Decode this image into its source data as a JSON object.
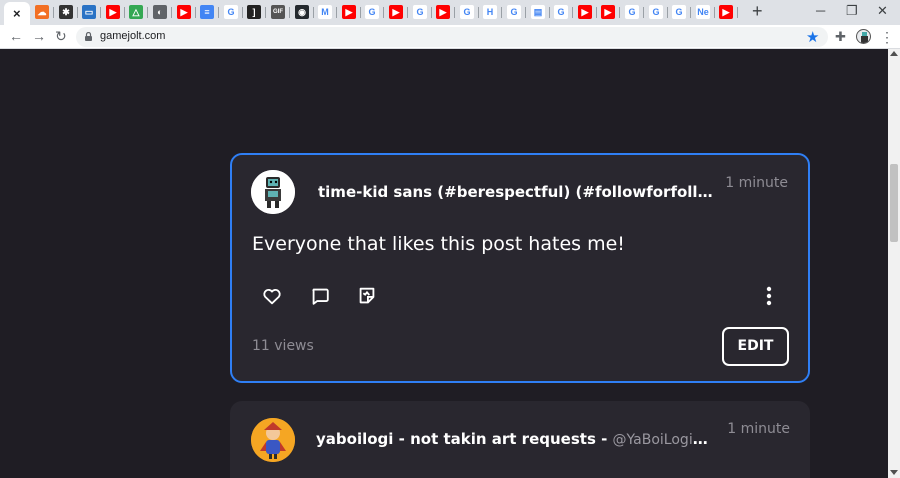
{
  "browser": {
    "tab_close_glyph": "×",
    "newtab_glyph": "+",
    "url": "gamejolt.com",
    "tabs": [
      {
        "icon": "soundcloud-icon",
        "color": "#f26f23",
        "glyph": "☁"
      },
      {
        "icon": "puzzle-dark-icon",
        "color": "#333333",
        "glyph": "✱"
      },
      {
        "icon": "blue-app-icon",
        "color": "#2a73c5",
        "glyph": "▭"
      },
      {
        "icon": "youtube-icon",
        "color": "#ff0000",
        "glyph": "▶"
      },
      {
        "icon": "google-drive-icon",
        "color": "#34a853",
        "glyph": "△"
      },
      {
        "icon": "globe-icon",
        "color": "#5f6368",
        "glyph": "◐"
      },
      {
        "icon": "youtube-icon",
        "color": "#ff0000",
        "glyph": "▶"
      },
      {
        "icon": "google-docs-icon",
        "color": "#4285f4",
        "glyph": "≡"
      },
      {
        "icon": "google-icon",
        "color": "#ffffff",
        "glyph": "G"
      },
      {
        "icon": "dark-tab-icon",
        "color": "#222222",
        "glyph": "]"
      },
      {
        "icon": "gif-icon",
        "color": "#555555",
        "glyph": "GIF"
      },
      {
        "icon": "github-icon",
        "color": "#24292e",
        "glyph": "◉"
      },
      {
        "icon": "gmail-icon",
        "color": "#ffffff",
        "glyph": "M"
      },
      {
        "icon": "youtube-icon",
        "color": "#ff0000",
        "glyph": "▶"
      },
      {
        "icon": "google-icon",
        "color": "#ffffff",
        "glyph": "G"
      },
      {
        "icon": "youtube-icon",
        "color": "#ff0000",
        "glyph": "▶"
      },
      {
        "icon": "google-icon",
        "color": "#ffffff",
        "glyph": "G"
      },
      {
        "icon": "youtube-icon",
        "color": "#ff0000",
        "glyph": "▶"
      },
      {
        "icon": "google-icon",
        "color": "#ffffff",
        "glyph": "G"
      },
      {
        "icon": "h-green-icon",
        "color": "#ffffff",
        "glyph": "H"
      },
      {
        "icon": "google-icon",
        "color": "#ffffff",
        "glyph": "G"
      },
      {
        "icon": "doc-red-icon",
        "color": "#ffffff",
        "glyph": "▤"
      },
      {
        "icon": "google-icon",
        "color": "#ffffff",
        "glyph": "G"
      },
      {
        "icon": "youtube-icon",
        "color": "#ff0000",
        "glyph": "▶"
      },
      {
        "icon": "youtube-icon",
        "color": "#ff0000",
        "glyph": "▶"
      },
      {
        "icon": "google-icon",
        "color": "#ffffff",
        "glyph": "G"
      },
      {
        "icon": "google-icon",
        "color": "#ffffff",
        "glyph": "G"
      },
      {
        "icon": "google-icon",
        "color": "#ffffff",
        "glyph": "G"
      },
      {
        "icon": "new-tab-label",
        "color": "#ffffff",
        "glyph": "Ne"
      },
      {
        "icon": "youtube-icon",
        "color": "#ff0000",
        "glyph": "▶"
      }
    ]
  },
  "feed": {
    "posts": [
      {
        "author": "time-kid sans (#berespectful) (#followforfollow) (...",
        "time": "1 minute",
        "text": "Everyone that likes this post hates me!",
        "views": "11 views",
        "edit_label": "EDIT"
      },
      {
        "author": "yaboilogi - not takin art requests - ",
        "handle": "@YaBoiLogi_Tha_...",
        "time": "1 minute"
      }
    ]
  },
  "colors": {
    "page_bg": "#1f1d24",
    "card_bg": "#29272f",
    "active_border": "#2f7ff5",
    "star": "#1a73e8"
  }
}
